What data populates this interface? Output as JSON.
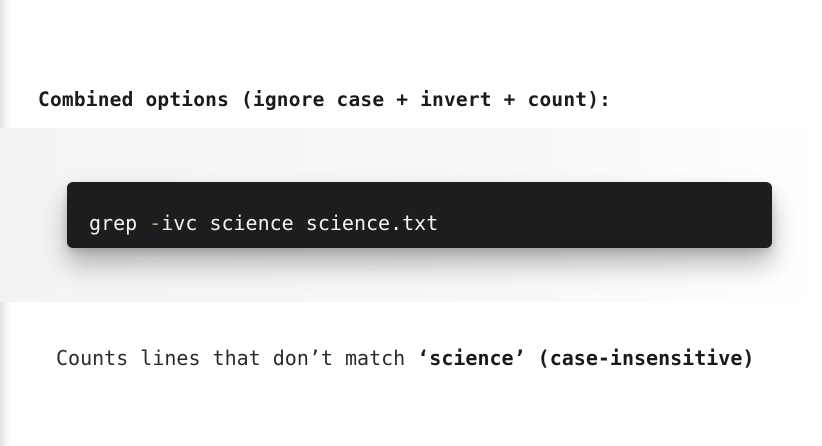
{
  "section": {
    "heading": "Combined options (ignore case + invert + count):"
  },
  "code": {
    "command": "grep",
    "flag_dash": "-",
    "flag_letters": "ivc",
    "pattern": "science",
    "file": "science.txt"
  },
  "description": {
    "prefix": "Counts lines that don’t match ",
    "term": "‘science’",
    "suffix": "(case-insensitive)"
  },
  "colors": {
    "code_background": "#1d1d1d",
    "code_text": "#f2f2f2",
    "flag_accent": "#d4a15a"
  }
}
